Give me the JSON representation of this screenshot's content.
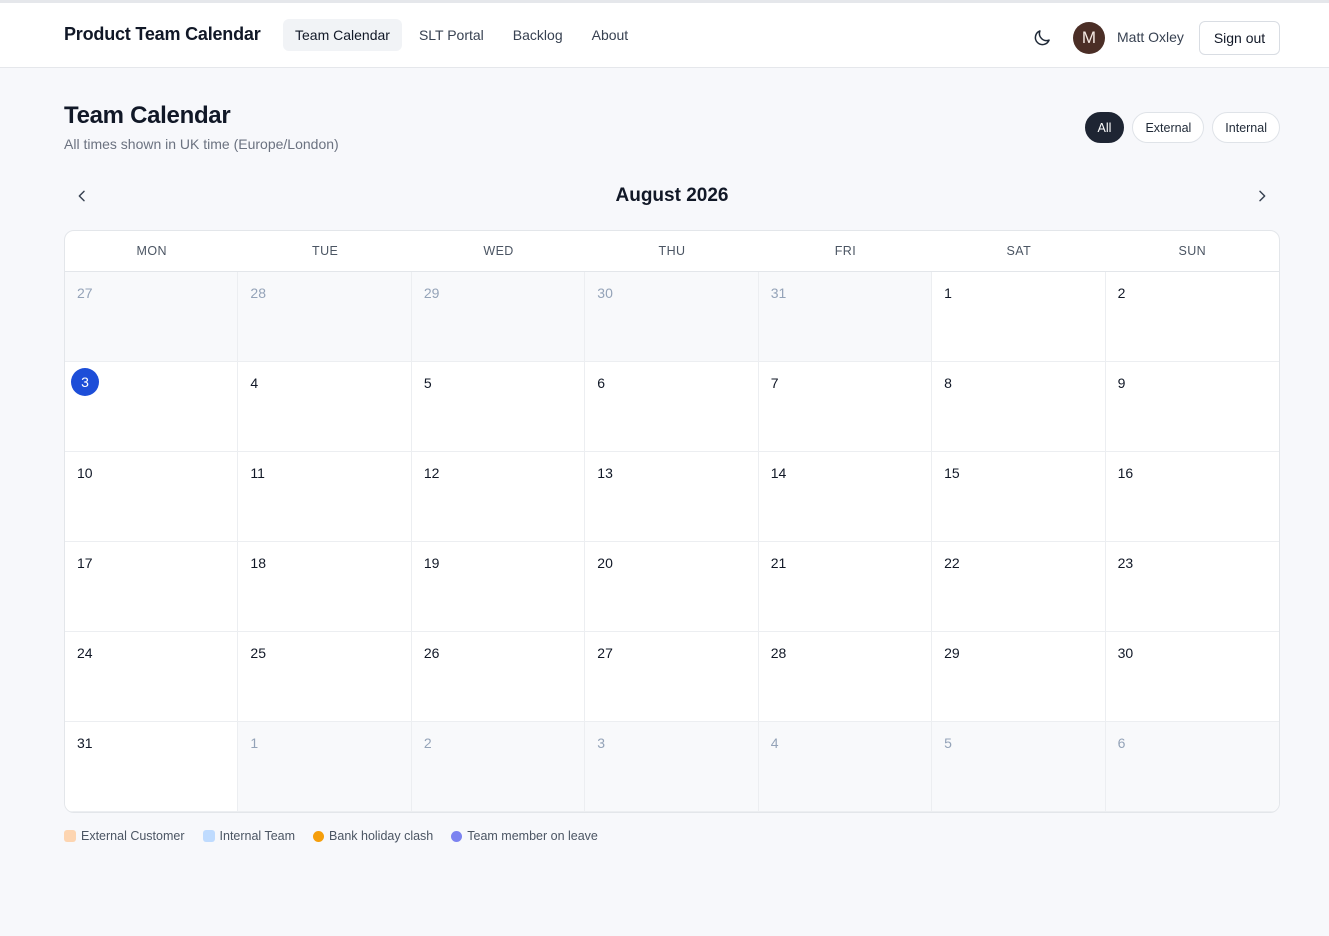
{
  "header": {
    "brand": "Product Team Calendar",
    "nav": [
      {
        "label": "Team Calendar",
        "active": true
      },
      {
        "label": "SLT Portal",
        "active": false
      },
      {
        "label": "Backlog",
        "active": false
      },
      {
        "label": "About",
        "active": false
      }
    ],
    "theme_icon": "moon-icon",
    "user": {
      "initial": "M",
      "name": "Matt Oxley"
    },
    "sign_out": "Sign out"
  },
  "page": {
    "title": "Team Calendar",
    "subtitle": "All times shown in UK time (Europe/London)",
    "filters": [
      {
        "label": "All",
        "active": true
      },
      {
        "label": "External",
        "active": false
      },
      {
        "label": "Internal",
        "active": false
      }
    ]
  },
  "calendar": {
    "month_label": "August 2026",
    "prev_icon": "chevron-left-icon",
    "next_icon": "chevron-right-icon",
    "weekdays": [
      "MON",
      "TUE",
      "WED",
      "THU",
      "FRI",
      "SAT",
      "SUN"
    ],
    "days": [
      {
        "day": "27",
        "outside": true
      },
      {
        "day": "28",
        "outside": true
      },
      {
        "day": "29",
        "outside": true
      },
      {
        "day": "30",
        "outside": true
      },
      {
        "day": "31",
        "outside": true
      },
      {
        "day": "1",
        "outside": false
      },
      {
        "day": "2",
        "outside": false
      },
      {
        "day": "3",
        "outside": false,
        "today": true
      },
      {
        "day": "4",
        "outside": false
      },
      {
        "day": "5",
        "outside": false
      },
      {
        "day": "6",
        "outside": false
      },
      {
        "day": "7",
        "outside": false
      },
      {
        "day": "8",
        "outside": false
      },
      {
        "day": "9",
        "outside": false
      },
      {
        "day": "10",
        "outside": false
      },
      {
        "day": "11",
        "outside": false
      },
      {
        "day": "12",
        "outside": false
      },
      {
        "day": "13",
        "outside": false
      },
      {
        "day": "14",
        "outside": false
      },
      {
        "day": "15",
        "outside": false
      },
      {
        "day": "16",
        "outside": false
      },
      {
        "day": "17",
        "outside": false
      },
      {
        "day": "18",
        "outside": false
      },
      {
        "day": "19",
        "outside": false
      },
      {
        "day": "20",
        "outside": false
      },
      {
        "day": "21",
        "outside": false
      },
      {
        "day": "22",
        "outside": false
      },
      {
        "day": "23",
        "outside": false
      },
      {
        "day": "24",
        "outside": false
      },
      {
        "day": "25",
        "outside": false
      },
      {
        "day": "26",
        "outside": false
      },
      {
        "day": "27",
        "outside": false
      },
      {
        "day": "28",
        "outside": false
      },
      {
        "day": "29",
        "outside": false
      },
      {
        "day": "30",
        "outside": false
      },
      {
        "day": "31",
        "outside": false
      },
      {
        "day": "1",
        "outside": true
      },
      {
        "day": "2",
        "outside": true
      },
      {
        "day": "3",
        "outside": true
      },
      {
        "day": "4",
        "outside": true
      },
      {
        "day": "5",
        "outside": true
      },
      {
        "day": "6",
        "outside": true
      }
    ]
  },
  "legend": [
    {
      "label": "External Customer",
      "color": "#fdd5b1",
      "shape": "square"
    },
    {
      "label": "Internal Team",
      "color": "#bfdbfe",
      "shape": "square"
    },
    {
      "label": "Bank holiday clash",
      "color": "#f59e0b",
      "shape": "dot"
    },
    {
      "label": "Team member on leave",
      "color": "#7c83f0",
      "shape": "dot"
    }
  ],
  "colors": {
    "accent_today": "#1d4ed8",
    "active_filter": "#1e2533",
    "avatar_bg": "#4b2e26"
  }
}
